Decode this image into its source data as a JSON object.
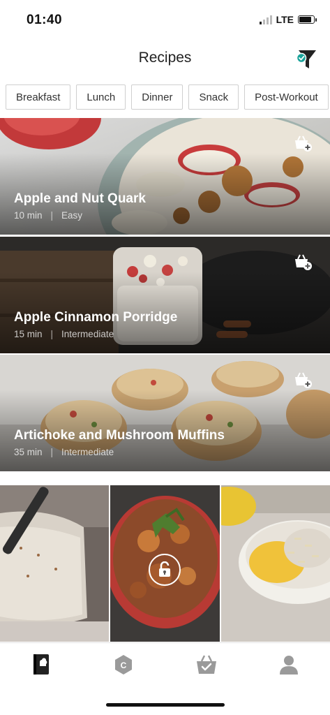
{
  "status": {
    "time": "01:40",
    "network": "LTE",
    "battery_level": 0.85
  },
  "header": {
    "title": "Recipes",
    "filter_icon": "filter-funnel-icon",
    "filter_active_color": "#1aa39a"
  },
  "categories": [
    {
      "label": "Breakfast"
    },
    {
      "label": "Lunch"
    },
    {
      "label": "Dinner"
    },
    {
      "label": "Snack"
    },
    {
      "label": "Post-Workout"
    }
  ],
  "recipes": [
    {
      "title": "Apple and Nut Quark",
      "time": "10 min",
      "separator": "|",
      "difficulty": "Easy",
      "action_icon": "add-to-plan-icon"
    },
    {
      "title": "Apple Cinnamon Porridge",
      "time": "15 min",
      "separator": "|",
      "difficulty": "Intermediate",
      "action_icon": "add-to-plan-icon"
    },
    {
      "title": "Artichoke and Mushroom Muffins",
      "time": "35 min",
      "separator": "|",
      "difficulty": "Intermediate",
      "action_icon": "add-to-plan-icon"
    }
  ],
  "locked_tiles": [
    {
      "icon": "smoothie-photo"
    },
    {
      "icon": "stew-photo",
      "lock_icon": "lock-icon"
    },
    {
      "icon": "yogurt-bowl-photo"
    }
  ],
  "tabs": [
    {
      "name": "recipes",
      "icon": "recipe-book-icon",
      "active": true
    },
    {
      "name": "coach",
      "icon": "coach-badge-icon",
      "active": false
    },
    {
      "name": "shopping",
      "icon": "shopping-basket-icon",
      "active": false
    },
    {
      "name": "profile",
      "icon": "profile-icon",
      "active": false
    }
  ],
  "colors": {
    "accent": "#1aa39a",
    "active_tab": "#222222",
    "inactive_tab": "#9a9a9a"
  }
}
